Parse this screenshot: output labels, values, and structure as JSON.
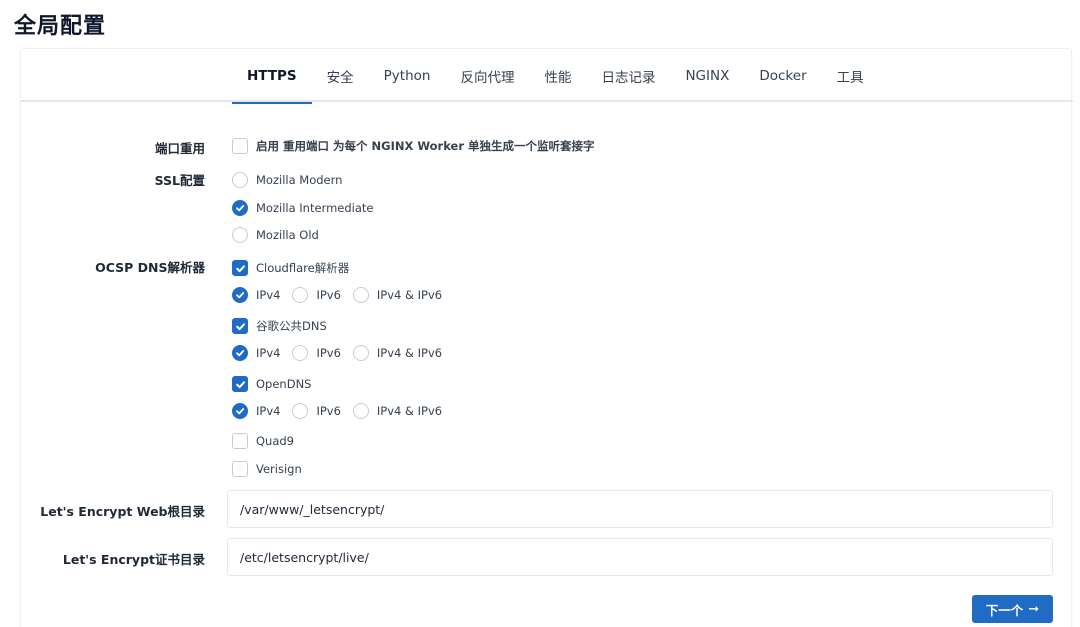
{
  "page": {
    "title": "全局配置"
  },
  "tabs": [
    {
      "label": "HTTPS",
      "active": true
    },
    {
      "label": "安全"
    },
    {
      "label": "Python"
    },
    {
      "label": "反向代理"
    },
    {
      "label": "性能"
    },
    {
      "label": "日志记录"
    },
    {
      "label": "NGINX"
    },
    {
      "label": "Docker"
    },
    {
      "label": "工具"
    }
  ],
  "form": {
    "reuseport": {
      "label": "端口重用",
      "checkbox_label": "启用 重用端口 为每个 NGINX Worker 单独生成一个监听套接字",
      "checked": false
    },
    "ssl": {
      "label": "SSL配置",
      "options": [
        {
          "label": "Mozilla Modern",
          "selected": false
        },
        {
          "label": "Mozilla Intermediate",
          "selected": true
        },
        {
          "label": "Mozilla Old",
          "selected": false
        }
      ]
    },
    "ocsp": {
      "label": "OCSP DNS解析器",
      "resolvers": [
        {
          "label": "Cloudflare解析器",
          "checked": true,
          "ip_options": [
            "IPv4",
            "IPv6",
            "IPv4 & IPv6"
          ],
          "ip_selected": "IPv4"
        },
        {
          "label": "谷歌公共DNS",
          "checked": true,
          "ip_options": [
            "IPv4",
            "IPv6",
            "IPv4 & IPv6"
          ],
          "ip_selected": "IPv4"
        },
        {
          "label": "OpenDNS",
          "checked": true,
          "ip_options": [
            "IPv4",
            "IPv6",
            "IPv4 & IPv6"
          ],
          "ip_selected": "IPv4"
        },
        {
          "label": "Quad9",
          "checked": false
        },
        {
          "label": "Verisign",
          "checked": false
        }
      ]
    },
    "le_webroot": {
      "label": "Let's Encrypt Web根目录",
      "value": "/var/www/_letsencrypt/"
    },
    "le_certdir": {
      "label": "Let's Encrypt证书目录",
      "value": "/etc/letsencrypt/live/"
    }
  },
  "actions": {
    "next_label": "下一个",
    "next_icon": "arrow-right-icon"
  },
  "colors": {
    "accent": "#206bc4",
    "border": "#e5e7eb"
  }
}
